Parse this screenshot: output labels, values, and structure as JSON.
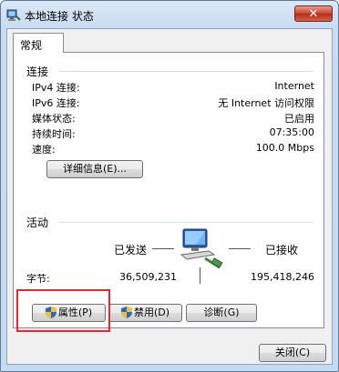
{
  "window": {
    "title": "本地连接 状态",
    "close_label": "✕"
  },
  "tab": {
    "label": "常规"
  },
  "connection": {
    "heading": "连接",
    "rows": [
      {
        "label": "IPv4 连接:",
        "value": "Internet"
      },
      {
        "label": "IPv6 连接:",
        "value": "无 Internet 访问权限"
      },
      {
        "label": "媒体状态:",
        "value": "已启用"
      },
      {
        "label": "持续时间:",
        "value": "07:35:00"
      },
      {
        "label": "速度:",
        "value": "100.0 Mbps"
      }
    ],
    "details_button": "详细信息(E)..."
  },
  "activity": {
    "heading": "活动",
    "sent_label": "已发送",
    "received_label": "已接收",
    "bytes_label": "字节:",
    "bytes_sent": "36,509,231",
    "bytes_received": "195,418,246"
  },
  "buttons": {
    "properties": "属性(P)",
    "disable": "禁用(D)",
    "diagnose": "诊断(G)",
    "close": "关闭(C)"
  },
  "colors": {
    "highlight": "#e8282e",
    "title_bg": "#c9dcf1",
    "close_red": "#c5452e"
  }
}
